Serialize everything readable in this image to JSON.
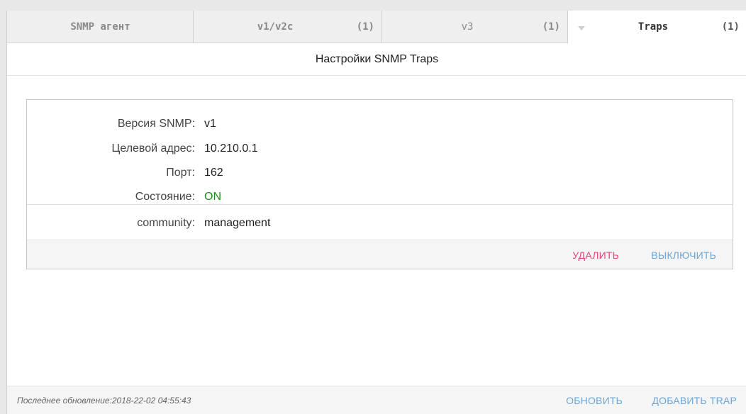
{
  "tabs": [
    {
      "label": "SNMP агент",
      "count": ""
    },
    {
      "label": "v1/v2c",
      "count": "(1)"
    },
    {
      "label": "v3",
      "count": "(1)"
    },
    {
      "label": "Traps",
      "count": "(1)"
    }
  ],
  "section_title": "Настройки SNMP Traps",
  "trap": {
    "version_label": "Версия SNMP:",
    "version_value": "v1",
    "target_label": "Целевой адрес:",
    "target_value": "10.210.0.1",
    "port_label": "Порт:",
    "port_value": "162",
    "state_label": "Состояние:",
    "state_value": "ON",
    "community_label": "community:",
    "community_value": "management",
    "delete_label": "УДАЛИТЬ",
    "disable_label": "ВЫКЛЮЧИТЬ"
  },
  "footer": {
    "last_update": "Последнее обновление:2018-22-02 04:55:43",
    "refresh_label": "ОБНОВИТЬ",
    "add_label": "ДОБАВИТЬ TRAP"
  },
  "colors": {
    "state_on": "#1f8a1f",
    "delete": "#e0457b",
    "action": "#6aa6d8"
  },
  "icons": {
    "active_tab_marker": "chevron-down-icon"
  }
}
